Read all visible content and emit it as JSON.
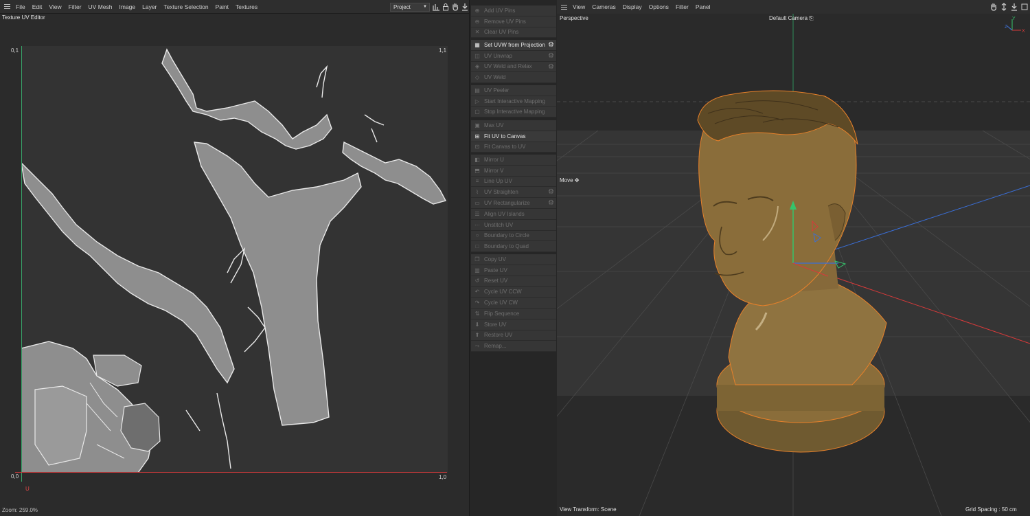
{
  "uv_editor": {
    "menu": [
      "File",
      "Edit",
      "View",
      "Filter",
      "UV Mesh",
      "Image",
      "Layer",
      "Texture Selection",
      "Paint",
      "Textures"
    ],
    "title": "Texture UV Editor",
    "project_select": "Project",
    "coords": {
      "top_left": "0,1",
      "top_right": "1,1",
      "bottom_left": "0,0",
      "bottom_right": "1,0"
    },
    "u_axis_label": "U",
    "zoom": "Zoom: 259.0%",
    "icons": [
      "graph-icon",
      "lock-icon",
      "hand-icon",
      "download-icon"
    ]
  },
  "commands": {
    "groups": [
      [
        {
          "label": "Add UV Pins",
          "icon": "pin-icon",
          "active": false
        },
        {
          "label": "Remove UV Pins",
          "icon": "pin-remove-icon",
          "active": false
        },
        {
          "label": "Clear UV Pins",
          "icon": "x-icon",
          "active": false
        }
      ],
      [
        {
          "label": "Set UVW from Projection",
          "icon": "projection-icon",
          "active": true,
          "gear": true
        },
        {
          "label": "UV Unwrap",
          "icon": "unwrap-icon",
          "active": false,
          "gear": true
        },
        {
          "label": "UV Weld and Relax",
          "icon": "weld-relax-icon",
          "active": false,
          "gear": true
        },
        {
          "label": "UV Weld",
          "icon": "weld-icon",
          "active": false
        }
      ],
      [
        {
          "label": "UV Peeler",
          "icon": "peeler-icon",
          "active": false
        },
        {
          "label": "Start Interactive Mapping",
          "icon": "play-icon",
          "active": false
        },
        {
          "label": "Stop Interactive Mapping",
          "icon": "stop-icon",
          "active": false
        }
      ],
      [
        {
          "label": "Max UV",
          "icon": "max-icon",
          "active": false
        },
        {
          "label": "Fit UV to Canvas",
          "icon": "fit-icon",
          "active": true
        },
        {
          "label": "Fit Canvas to UV",
          "icon": "fit-canvas-icon",
          "active": false
        }
      ],
      [
        {
          "label": "Mirror U",
          "icon": "mirror-u-icon",
          "active": false
        },
        {
          "label": "Mirror V",
          "icon": "mirror-v-icon",
          "active": false
        },
        {
          "label": "Line Up UV",
          "icon": "lineup-icon",
          "active": false
        },
        {
          "label": "UV Straighten",
          "icon": "straighten-icon",
          "active": false,
          "gear": true
        },
        {
          "label": "UV Rectangularize",
          "icon": "rectangularize-icon",
          "active": false,
          "gear": true
        },
        {
          "label": "Align UV Islands",
          "icon": "align-icon",
          "active": false
        },
        {
          "label": "Unstitch UV",
          "icon": "unstitch-icon",
          "active": false
        },
        {
          "label": "Boundary to Circle",
          "icon": "circle-icon",
          "active": false
        },
        {
          "label": "Boundary to Quad",
          "icon": "quad-icon",
          "active": false
        }
      ],
      [
        {
          "label": "Copy UV",
          "icon": "copy-icon",
          "active": false
        },
        {
          "label": "Paste UV",
          "icon": "paste-icon",
          "active": false
        },
        {
          "label": "Reset UV",
          "icon": "reset-icon",
          "active": false
        },
        {
          "label": "Cycle UV CCW",
          "icon": "cycle-ccw-icon",
          "active": false
        },
        {
          "label": "Cycle UV CW",
          "icon": "cycle-cw-icon",
          "active": false
        },
        {
          "label": "Flip Sequence",
          "icon": "flip-icon",
          "active": false
        },
        {
          "label": "Store UV",
          "icon": "store-icon",
          "active": false
        },
        {
          "label": "Restore UV",
          "icon": "restore-icon",
          "active": false
        },
        {
          "label": "Remap...",
          "icon": "remap-icon",
          "active": false
        }
      ]
    ]
  },
  "viewport": {
    "menu": [
      "View",
      "Cameras",
      "Display",
      "Options",
      "Filter",
      "Panel"
    ],
    "view_name": "Perspective",
    "camera": "Default Camera",
    "tool": "Move",
    "view_transform": "View Transform: Scene",
    "grid_spacing": "Grid Spacing : 50 cm",
    "axis_labels": {
      "y": "Y",
      "z": "Z",
      "x": "X"
    },
    "colors": {
      "x_axis": "#d83a3a",
      "y_axis": "#35c46b",
      "z_axis": "#3a6fd8",
      "selection": "#e8812a",
      "bust": "#8a6d3a"
    }
  }
}
